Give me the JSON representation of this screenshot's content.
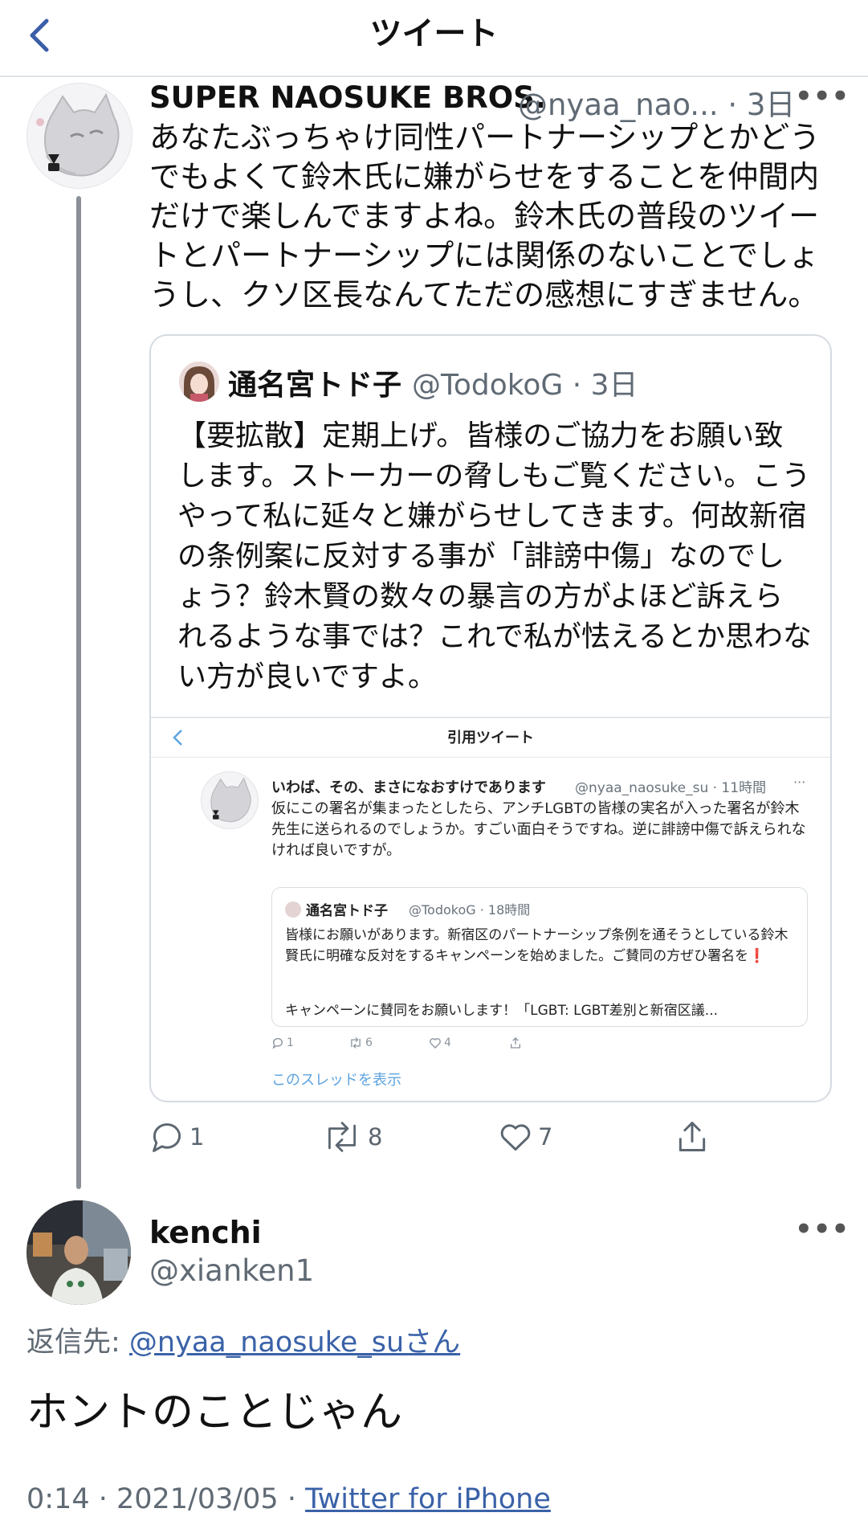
{
  "header": {
    "title": "ツイート"
  },
  "tweet1": {
    "name": "SUPER NAOSUKE BROS.",
    "handle_time": "@nyaa_nao... · 3日",
    "more": "•••",
    "body": "あなたぶっちゃけ同性パートナーシップとかどうでもよくて鈴木氏に嫌がらせをすることを仲間内だけで楽しんでますよね。鈴木氏の普段のツイートとパートナーシップには関係のないことでしょうし、クソ区長なんてただの感想にすぎません。",
    "quote": {
      "name": "通名宮トド子",
      "handle_time": "@TodokoG · 3日",
      "body": "【要拡散】定期上げ。皆様のご協力をお願い致します。ストーカーの脅しもご覧ください。こうやって私に延々と嫌がらせしてきます。何故新宿の条例案に反対する事が「誹謗中傷」なのでしょう？鈴木賢の数々の暴言の方がよほど訴えられるような事では？これで私が怯えるとか思わない方が良いですよ。",
      "embed": {
        "title": "引用ツイート",
        "name": "いわば、その、まさになおすけであります",
        "handle_time": "@nyaa_naosuke_su · 11時間",
        "more": "···",
        "body": "仮にこの署名が集まったとしたら、アンチLGBTの皆様の実名が入った署名が鈴木先生に送られるのでしょうか。すごい面白そうですね。逆に誹謗中傷で訴えられなければ良いですが。",
        "inner": {
          "name": "通名宮トド子",
          "handle_time": "@TodokoG · 18時間",
          "body": "皆様にお願いがあります。新宿区のパートナーシップ条例を通そうとしている鈴木賢氏に明確な反対をするキャンペーンを始めました。ご賛同の方ぜひ署名を❗",
          "body2": "キャンペーンに賛同をお願いします！「LGBT: LGBT差別と新宿区議..."
        },
        "actions": {
          "reply": "1",
          "retweet": "6",
          "like": "4"
        },
        "show_thread": "このスレッドを表示"
      }
    },
    "actions": {
      "reply": "1",
      "retweet": "8",
      "like": "7"
    }
  },
  "tweet2": {
    "name": "kenchi",
    "handle": "@xianken1",
    "more": "•••",
    "reply_prefix": "返信先: ",
    "reply_link": "@nyaa_naosuke_suさん",
    "body": "ホントのことじゃん",
    "meta_prefix": "0:14 · 2021/03/05 · ",
    "client": "Twitter for iPhone"
  },
  "icons": {
    "back": "chevron-left-icon",
    "reply": "reply-icon",
    "retweet": "retweet-icon",
    "like": "heart-icon",
    "share": "share-icon"
  },
  "colors": {
    "link": "#3a62a8",
    "thread_line": "#8b9096",
    "show_thread": "#5ea4e0"
  }
}
